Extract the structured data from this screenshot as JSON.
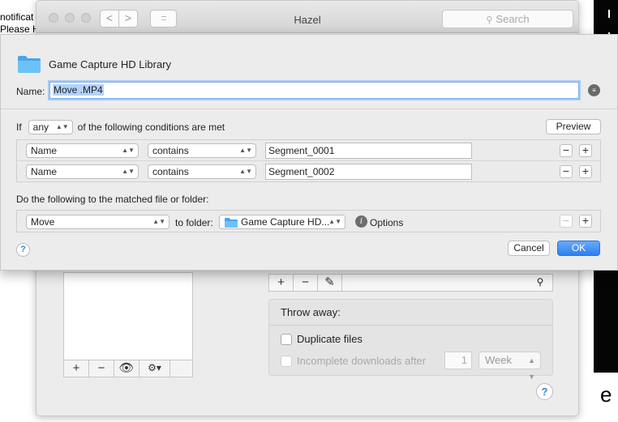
{
  "background": {
    "fragment_lines": [
      "notificat",
      "Please H"
    ],
    "edge_glyph": "e"
  },
  "window": {
    "title": "Hazel",
    "search_placeholder": "Search",
    "nav_back": "<",
    "nav_forward": ">",
    "grid_glyph": "::::"
  },
  "main": {
    "list_buttons": [
      "+",
      "−",
      "👁",
      "⚙▾"
    ],
    "toolbar_buttons": [
      "+",
      "−",
      "✎"
    ],
    "throw_away": {
      "title": "Throw away:",
      "duplicate_label": "Duplicate files",
      "duplicate_checked": false,
      "incomplete_label": "Incomplete downloads after",
      "incomplete_checked": false,
      "incomplete_count": "1",
      "incomplete_unit": "Week"
    },
    "help_label": "?"
  },
  "sheet": {
    "folder_name": "Game Capture HD Library",
    "name_label": "Name:",
    "name_value": "Move .MP4",
    "if_label": "If",
    "match_mode": "any",
    "conditions_suffix": "of the following conditions are met",
    "preview_label": "Preview",
    "conditions": [
      {
        "attribute": "Name",
        "operator": "contains",
        "value": "Segment_0001"
      },
      {
        "attribute": "Name",
        "operator": "contains",
        "value": "Segment_0002"
      }
    ],
    "actions_label": "Do the following to the matched file or folder:",
    "action": {
      "verb": "Move",
      "to_label": "to folder:",
      "folder": "Game Capture HD...",
      "options_label": "Options"
    },
    "plus_label": "+",
    "minus_label": "−",
    "help_label": "?",
    "cancel_label": "Cancel",
    "ok_label": "OK"
  },
  "colors": {
    "accent": "#2e7ff0",
    "folder_blue": "#5cb8f5"
  }
}
